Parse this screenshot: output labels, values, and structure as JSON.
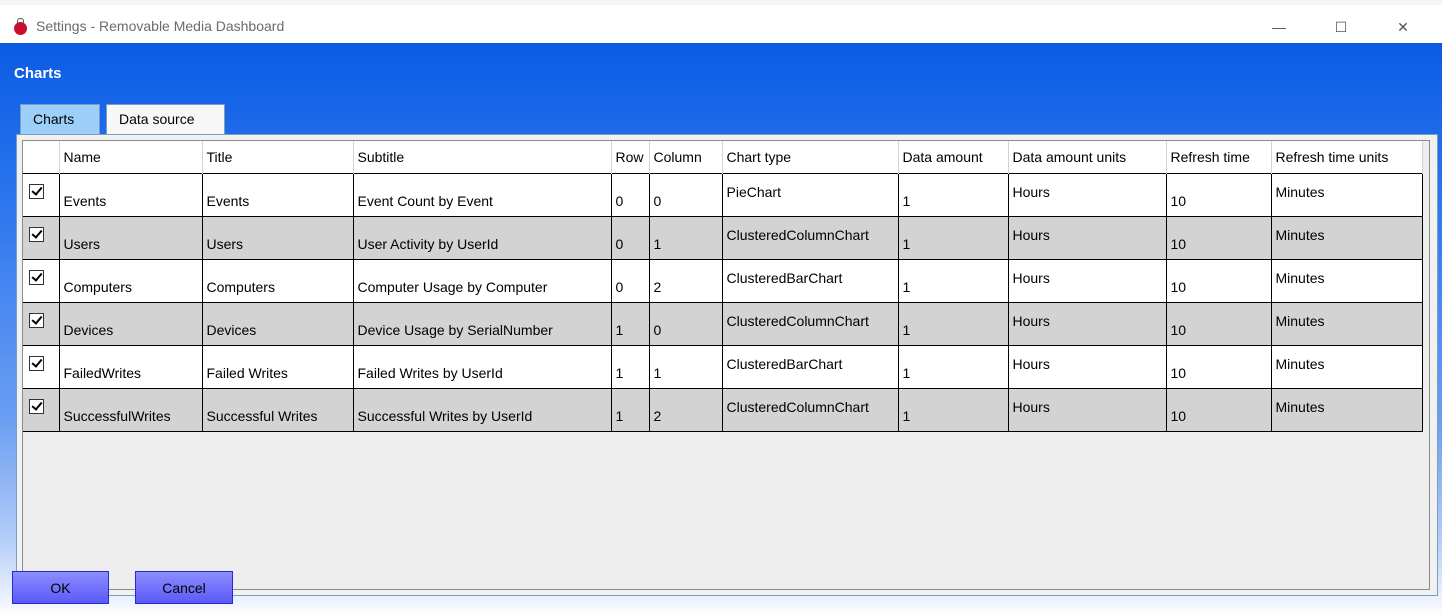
{
  "window": {
    "title": "Settings - Removable Media Dashboard",
    "controls": {
      "minimize": "—",
      "maximize": "☐",
      "close": "✕"
    }
  },
  "section_title": "Charts",
  "tabs": [
    {
      "label": "Charts",
      "active": true
    },
    {
      "label": "Data source",
      "active": false
    }
  ],
  "grid": {
    "columns": [
      "",
      "Name",
      "Title",
      "Subtitle",
      "Row",
      "Column",
      "Chart type",
      "Data amount",
      "Data amount units",
      "Refresh time",
      "Refresh time units"
    ],
    "rows": [
      {
        "checked": true,
        "name": "Events",
        "title": "Events",
        "subtitle": "Event Count by Event",
        "row": "0",
        "column": "0",
        "chart_type": "PieChart",
        "data_amount": "1",
        "data_amount_units": "Hours",
        "refresh_time": "10",
        "refresh_time_units": "Minutes"
      },
      {
        "checked": true,
        "name": "Users",
        "title": "Users",
        "subtitle": "User Activity by UserId",
        "row": "0",
        "column": "1",
        "chart_type": "ClusteredColumnChart",
        "data_amount": "1",
        "data_amount_units": "Hours",
        "refresh_time": "10",
        "refresh_time_units": "Minutes"
      },
      {
        "checked": true,
        "name": "Computers",
        "title": "Computers",
        "subtitle": "Computer Usage by Computer",
        "row": "0",
        "column": "2",
        "chart_type": "ClusteredBarChart",
        "data_amount": "1",
        "data_amount_units": "Hours",
        "refresh_time": "10",
        "refresh_time_units": "Minutes"
      },
      {
        "checked": true,
        "name": "Devices",
        "title": "Devices",
        "subtitle": "Device Usage by SerialNumber",
        "row": "1",
        "column": "0",
        "chart_type": "ClusteredColumnChart",
        "data_amount": "1",
        "data_amount_units": "Hours",
        "refresh_time": "10",
        "refresh_time_units": "Minutes"
      },
      {
        "checked": true,
        "name": "FailedWrites",
        "title": "Failed Writes",
        "subtitle": "Failed Writes by UserId",
        "row": "1",
        "column": "1",
        "chart_type": "ClusteredBarChart",
        "data_amount": "1",
        "data_amount_units": "Hours",
        "refresh_time": "10",
        "refresh_time_units": "Minutes"
      },
      {
        "checked": true,
        "name": "SuccessfulWrites",
        "title": "Successful Writes",
        "subtitle": "Successful Writes by UserId",
        "row": "1",
        "column": "2",
        "chart_type": "ClusteredColumnChart",
        "data_amount": "1",
        "data_amount_units": "Hours",
        "refresh_time": "10",
        "refresh_time_units": "Minutes"
      }
    ]
  },
  "buttons": {
    "ok": "OK",
    "cancel": "Cancel"
  },
  "colors": {
    "header_blue": "#0b5be3",
    "tab_active": "#9ccffa",
    "button": "#6b6bff",
    "row_alt": "#d3d3d3"
  }
}
